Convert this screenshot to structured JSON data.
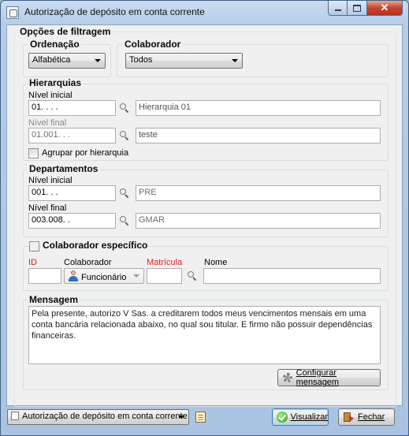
{
  "window": {
    "title": "Autorização de depósito em conta corrente"
  },
  "filters": {
    "group_title": "Opções de filtragem",
    "ordering": {
      "label": "Ordenação",
      "value": "Alfabética"
    },
    "collaborator": {
      "label": "Colaborador",
      "value": "Todos"
    }
  },
  "hierarchies": {
    "title": "Hierarquias",
    "initial_label": "Nível inicial",
    "initial_value": "01.   .   .   .",
    "initial_desc": "Hierarquia 01",
    "final_label": "Nível final",
    "final_value": "01.001.   .   .",
    "final_desc": "teste",
    "group_label": "Agrupar por hierarquia"
  },
  "departments": {
    "title": "Departamentos",
    "initial_label": "Nível inicial",
    "initial_value": "001.   .   .",
    "initial_desc": "PRE",
    "final_label": "Nível final",
    "final_value": "003.008.   .",
    "final_desc": "GMAR"
  },
  "specific": {
    "title": "Colaborador específico",
    "id_label": "ID",
    "collab_label": "Colaborador",
    "collab_value": "Funcionário",
    "registration_label": "Matrícula",
    "name_label": "Nome",
    "id_value": "",
    "registration_value": "",
    "name_value": ""
  },
  "message": {
    "title": "Mensagem",
    "text": "Pela presente, autorizo V Sas. a creditarem todos meus vencimentos mensais em uma conta bancária relacionada abaixo, no qual sou titular. E firmo não possuir dependências financeiras.",
    "configure_button": "Configurar mensagem"
  },
  "footer": {
    "report_value": "Autorização de depósito em conta corrente",
    "preview_button": "Visualizar",
    "close_button": "Fechar"
  },
  "colors": {
    "required_label": "#e0201d",
    "window_frame": "#b6cde8"
  }
}
